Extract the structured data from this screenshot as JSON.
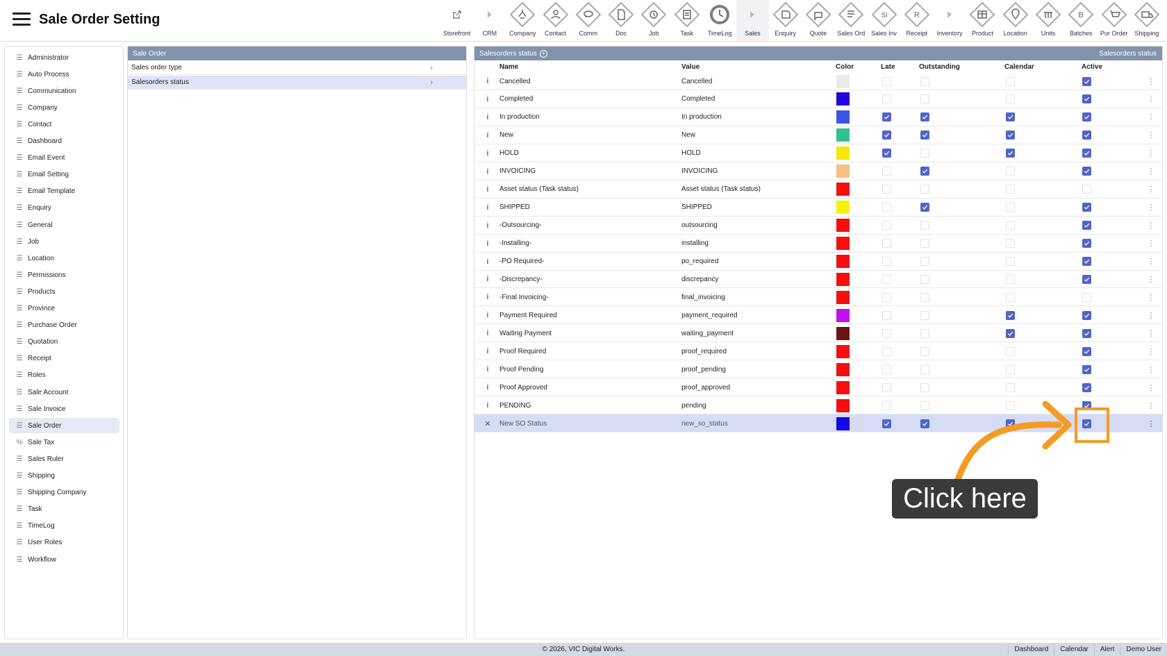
{
  "app": {
    "title": "Sale Order Setting"
  },
  "toolbar": [
    {
      "label": "Storefront",
      "icon": "external-link-icon"
    },
    {
      "label": "CRM",
      "icon": "play-right-icon"
    },
    {
      "label": "Company",
      "icon": "company-icon"
    },
    {
      "label": "Contact",
      "icon": "contact-icon"
    },
    {
      "label": "Comm",
      "icon": "communication-icon"
    },
    {
      "label": "Doc",
      "icon": "document-icon"
    },
    {
      "label": "Job",
      "icon": "job-icon"
    },
    {
      "label": "Task",
      "icon": "task-icon"
    },
    {
      "label": "TimeLog",
      "icon": "timelog-icon"
    },
    {
      "label": "Sales",
      "icon": "play-right-icon"
    },
    {
      "label": "Enquiry",
      "icon": "enquiry-icon"
    },
    {
      "label": "Quote",
      "icon": "quote-icon"
    },
    {
      "label": "Sales Ord",
      "icon": "sales-order-icon"
    },
    {
      "label": "Sales Inv",
      "icon": "sales-invoice-icon"
    },
    {
      "label": "Receipt",
      "icon": "receipt-icon"
    },
    {
      "label": "Inventory",
      "icon": "play-right-icon"
    },
    {
      "label": "Product",
      "icon": "product-icon"
    },
    {
      "label": "Location",
      "icon": "location-icon"
    },
    {
      "label": "Units",
      "icon": "units-icon"
    },
    {
      "label": "Batches",
      "icon": "batches-icon"
    },
    {
      "label": "Pur Order",
      "icon": "purchase-order-icon"
    },
    {
      "label": "Shipping",
      "icon": "shipping-icon"
    }
  ],
  "toolbar_letters": {
    "sales_inv": "Si",
    "receipt": "R",
    "batches": "B"
  },
  "sidebar": {
    "items": [
      "Administrator",
      "Auto Process",
      "Communication",
      "Company",
      "Contact",
      "Dashboard",
      "Email Event",
      "Email Setting",
      "Email Template",
      "Enquiry",
      "General",
      "Job",
      "Location",
      "Permissions",
      "Products",
      "Province",
      "Purchase Order",
      "Quotation",
      "Receipt",
      "Roles",
      "Sale Account",
      "Sale Invoice",
      "Sale Order",
      "Sale Tax",
      "Sales Ruler",
      "Shipping",
      "Shipping Company",
      "Task",
      "TimeLog",
      "User Roles",
      "Workflow"
    ],
    "active": "Sale Order"
  },
  "mid_panel": {
    "title": "Sale Order",
    "items": [
      {
        "label": "Sales order type",
        "active": false
      },
      {
        "label": "Salesorders status",
        "active": true
      }
    ]
  },
  "right_panel": {
    "title": "Salesorders status",
    "title_right": "Salesorders status",
    "columns": {
      "name": "Name",
      "value": "Value",
      "color": "Color",
      "late": "Late",
      "outstanding": "Outstanding",
      "calendar": "Calendar",
      "active": "Active"
    },
    "rows": [
      {
        "name": "Cancelled",
        "value": "Cancelled",
        "color": "#e9e9e9",
        "late": false,
        "outstanding": false,
        "calendar": false,
        "active": true
      },
      {
        "name": "Completed",
        "value": "Completed",
        "color": "#2108d6",
        "late": false,
        "outstanding": false,
        "calendar": false,
        "active": true
      },
      {
        "name": "In production",
        "value": "In production",
        "color": "#3d56e0",
        "late": true,
        "outstanding": true,
        "calendar": true,
        "active": true
      },
      {
        "name": "New",
        "value": "New",
        "color": "#34bf8f",
        "late": true,
        "outstanding": true,
        "calendar": true,
        "active": true
      },
      {
        "name": "HOLD",
        "value": "HOLD",
        "color": "#f7e70a",
        "late": true,
        "outstanding": false,
        "calendar": true,
        "active": true
      },
      {
        "name": "INVOICING",
        "value": "INVOICING",
        "color": "#f5bf86",
        "late": false,
        "outstanding": true,
        "calendar": false,
        "active": true
      },
      {
        "name": "Asset status (Task status)",
        "value": "Asset status (Task status)",
        "color": "#f50f0f",
        "late": false,
        "outstanding": false,
        "calendar": false,
        "active": false
      },
      {
        "name": "SHIPPED",
        "value": "SHIPPED",
        "color": "#f5f20a",
        "late": false,
        "outstanding": true,
        "calendar": false,
        "active": true
      },
      {
        "name": "-Outsourcing-",
        "value": "outsourcing",
        "color": "#f50f0f",
        "late": false,
        "outstanding": false,
        "calendar": false,
        "active": true
      },
      {
        "name": "-Installing-",
        "value": "installing",
        "color": "#f50f0f",
        "late": false,
        "outstanding": false,
        "calendar": false,
        "active": true
      },
      {
        "name": "-PO Required-",
        "value": "po_required",
        "color": "#f50f0f",
        "late": false,
        "outstanding": false,
        "calendar": false,
        "active": true
      },
      {
        "name": "-Discrepancy-",
        "value": "discrepancy",
        "color": "#f50f0f",
        "late": false,
        "outstanding": false,
        "calendar": false,
        "active": true
      },
      {
        "name": "-Final Invoicing-",
        "value": "final_invoicing",
        "color": "#f50f0f",
        "late": false,
        "outstanding": false,
        "calendar": false,
        "active": false
      },
      {
        "name": "Payment Required",
        "value": "payment_required",
        "color": "#c40ef2",
        "late": false,
        "outstanding": false,
        "calendar": true,
        "active": true
      },
      {
        "name": "Waiting Payment",
        "value": "waiting_payment",
        "color": "#6b1414",
        "late": false,
        "outstanding": false,
        "calendar": true,
        "active": true
      },
      {
        "name": "Proof Required",
        "value": "proof_required",
        "color": "#f50f0f",
        "late": false,
        "outstanding": false,
        "calendar": false,
        "active": true
      },
      {
        "name": "Proof Pending",
        "value": "proof_pending",
        "color": "#f50f0f",
        "late": false,
        "outstanding": false,
        "calendar": false,
        "active": true
      },
      {
        "name": "Proof Approved",
        "value": "proof_approved",
        "color": "#f50f0f",
        "late": false,
        "outstanding": false,
        "calendar": false,
        "active": true
      },
      {
        "name": "PENDING",
        "value": "pending",
        "color": "#f50f0f",
        "late": false,
        "outstanding": false,
        "calendar": false,
        "active": true
      },
      {
        "name": "New SO Status",
        "value": "new_so_status",
        "color": "#1208e6",
        "late": true,
        "outstanding": true,
        "calendar": true,
        "active": true,
        "highlight": true
      }
    ]
  },
  "footer": {
    "copyright": "© 2026, VIC Digital Works.",
    "links": [
      "Dashboard",
      "Calendar",
      "Alert",
      "Demo User"
    ]
  },
  "callout": {
    "text": "Click here"
  },
  "colors": {
    "header_bar": "#8293ab",
    "checkbox_on": "#4f65c9",
    "row_highlight": "#d6dcf4",
    "annotation": "#f49b24"
  }
}
